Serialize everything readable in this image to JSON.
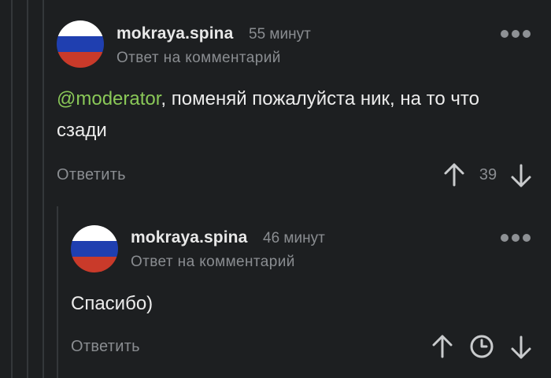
{
  "comments": [
    {
      "author": "mokraya.spina",
      "time": "55 минут",
      "reply_meta": "Ответ на комментарий",
      "mention": "@moderator",
      "text_line1": ", поменяй пожалуйста ник, на то что",
      "text_line2": "сзади",
      "reply_label": "Ответить",
      "rating": "39"
    },
    {
      "author": "mokraya.spina",
      "time": "46 минут",
      "reply_meta": "Ответ на комментарий",
      "text": "Спасибо)",
      "reply_label": "Ответить"
    }
  ],
  "colors": {
    "background": "#1d1f21",
    "mention": "#8ac858",
    "muted_text": "#8a8d91",
    "thread_line": "#34373a"
  },
  "icons": {
    "avatar": "russian-flag-avatar",
    "more": "more-dots-icon",
    "upvote": "arrow-up-icon",
    "downvote": "arrow-down-icon",
    "pending_rating": "clock-icon"
  }
}
